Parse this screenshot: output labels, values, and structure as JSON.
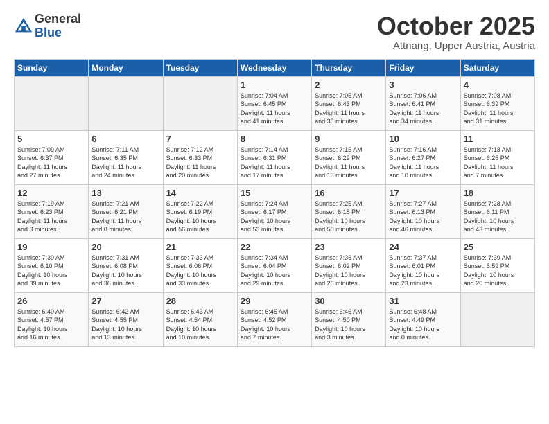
{
  "header": {
    "logo_general": "General",
    "logo_blue": "Blue",
    "month_title": "October 2025",
    "location": "Attnang, Upper Austria, Austria"
  },
  "weekdays": [
    "Sunday",
    "Monday",
    "Tuesday",
    "Wednesday",
    "Thursday",
    "Friday",
    "Saturday"
  ],
  "weeks": [
    [
      {
        "day": "",
        "info": ""
      },
      {
        "day": "",
        "info": ""
      },
      {
        "day": "",
        "info": ""
      },
      {
        "day": "1",
        "info": "Sunrise: 7:04 AM\nSunset: 6:45 PM\nDaylight: 11 hours\nand 41 minutes."
      },
      {
        "day": "2",
        "info": "Sunrise: 7:05 AM\nSunset: 6:43 PM\nDaylight: 11 hours\nand 38 minutes."
      },
      {
        "day": "3",
        "info": "Sunrise: 7:06 AM\nSunset: 6:41 PM\nDaylight: 11 hours\nand 34 minutes."
      },
      {
        "day": "4",
        "info": "Sunrise: 7:08 AM\nSunset: 6:39 PM\nDaylight: 11 hours\nand 31 minutes."
      }
    ],
    [
      {
        "day": "5",
        "info": "Sunrise: 7:09 AM\nSunset: 6:37 PM\nDaylight: 11 hours\nand 27 minutes."
      },
      {
        "day": "6",
        "info": "Sunrise: 7:11 AM\nSunset: 6:35 PM\nDaylight: 11 hours\nand 24 minutes."
      },
      {
        "day": "7",
        "info": "Sunrise: 7:12 AM\nSunset: 6:33 PM\nDaylight: 11 hours\nand 20 minutes."
      },
      {
        "day": "8",
        "info": "Sunrise: 7:14 AM\nSunset: 6:31 PM\nDaylight: 11 hours\nand 17 minutes."
      },
      {
        "day": "9",
        "info": "Sunrise: 7:15 AM\nSunset: 6:29 PM\nDaylight: 11 hours\nand 13 minutes."
      },
      {
        "day": "10",
        "info": "Sunrise: 7:16 AM\nSunset: 6:27 PM\nDaylight: 11 hours\nand 10 minutes."
      },
      {
        "day": "11",
        "info": "Sunrise: 7:18 AM\nSunset: 6:25 PM\nDaylight: 11 hours\nand 7 minutes."
      }
    ],
    [
      {
        "day": "12",
        "info": "Sunrise: 7:19 AM\nSunset: 6:23 PM\nDaylight: 11 hours\nand 3 minutes."
      },
      {
        "day": "13",
        "info": "Sunrise: 7:21 AM\nSunset: 6:21 PM\nDaylight: 11 hours\nand 0 minutes."
      },
      {
        "day": "14",
        "info": "Sunrise: 7:22 AM\nSunset: 6:19 PM\nDaylight: 10 hours\nand 56 minutes."
      },
      {
        "day": "15",
        "info": "Sunrise: 7:24 AM\nSunset: 6:17 PM\nDaylight: 10 hours\nand 53 minutes."
      },
      {
        "day": "16",
        "info": "Sunrise: 7:25 AM\nSunset: 6:15 PM\nDaylight: 10 hours\nand 50 minutes."
      },
      {
        "day": "17",
        "info": "Sunrise: 7:27 AM\nSunset: 6:13 PM\nDaylight: 10 hours\nand 46 minutes."
      },
      {
        "day": "18",
        "info": "Sunrise: 7:28 AM\nSunset: 6:11 PM\nDaylight: 10 hours\nand 43 minutes."
      }
    ],
    [
      {
        "day": "19",
        "info": "Sunrise: 7:30 AM\nSunset: 6:10 PM\nDaylight: 10 hours\nand 39 minutes."
      },
      {
        "day": "20",
        "info": "Sunrise: 7:31 AM\nSunset: 6:08 PM\nDaylight: 10 hours\nand 36 minutes."
      },
      {
        "day": "21",
        "info": "Sunrise: 7:33 AM\nSunset: 6:06 PM\nDaylight: 10 hours\nand 33 minutes."
      },
      {
        "day": "22",
        "info": "Sunrise: 7:34 AM\nSunset: 6:04 PM\nDaylight: 10 hours\nand 29 minutes."
      },
      {
        "day": "23",
        "info": "Sunrise: 7:36 AM\nSunset: 6:02 PM\nDaylight: 10 hours\nand 26 minutes."
      },
      {
        "day": "24",
        "info": "Sunrise: 7:37 AM\nSunset: 6:01 PM\nDaylight: 10 hours\nand 23 minutes."
      },
      {
        "day": "25",
        "info": "Sunrise: 7:39 AM\nSunset: 5:59 PM\nDaylight: 10 hours\nand 20 minutes."
      }
    ],
    [
      {
        "day": "26",
        "info": "Sunrise: 6:40 AM\nSunset: 4:57 PM\nDaylight: 10 hours\nand 16 minutes."
      },
      {
        "day": "27",
        "info": "Sunrise: 6:42 AM\nSunset: 4:55 PM\nDaylight: 10 hours\nand 13 minutes."
      },
      {
        "day": "28",
        "info": "Sunrise: 6:43 AM\nSunset: 4:54 PM\nDaylight: 10 hours\nand 10 minutes."
      },
      {
        "day": "29",
        "info": "Sunrise: 6:45 AM\nSunset: 4:52 PM\nDaylight: 10 hours\nand 7 minutes."
      },
      {
        "day": "30",
        "info": "Sunrise: 6:46 AM\nSunset: 4:50 PM\nDaylight: 10 hours\nand 3 minutes."
      },
      {
        "day": "31",
        "info": "Sunrise: 6:48 AM\nSunset: 4:49 PM\nDaylight: 10 hours\nand 0 minutes."
      },
      {
        "day": "",
        "info": ""
      }
    ]
  ]
}
